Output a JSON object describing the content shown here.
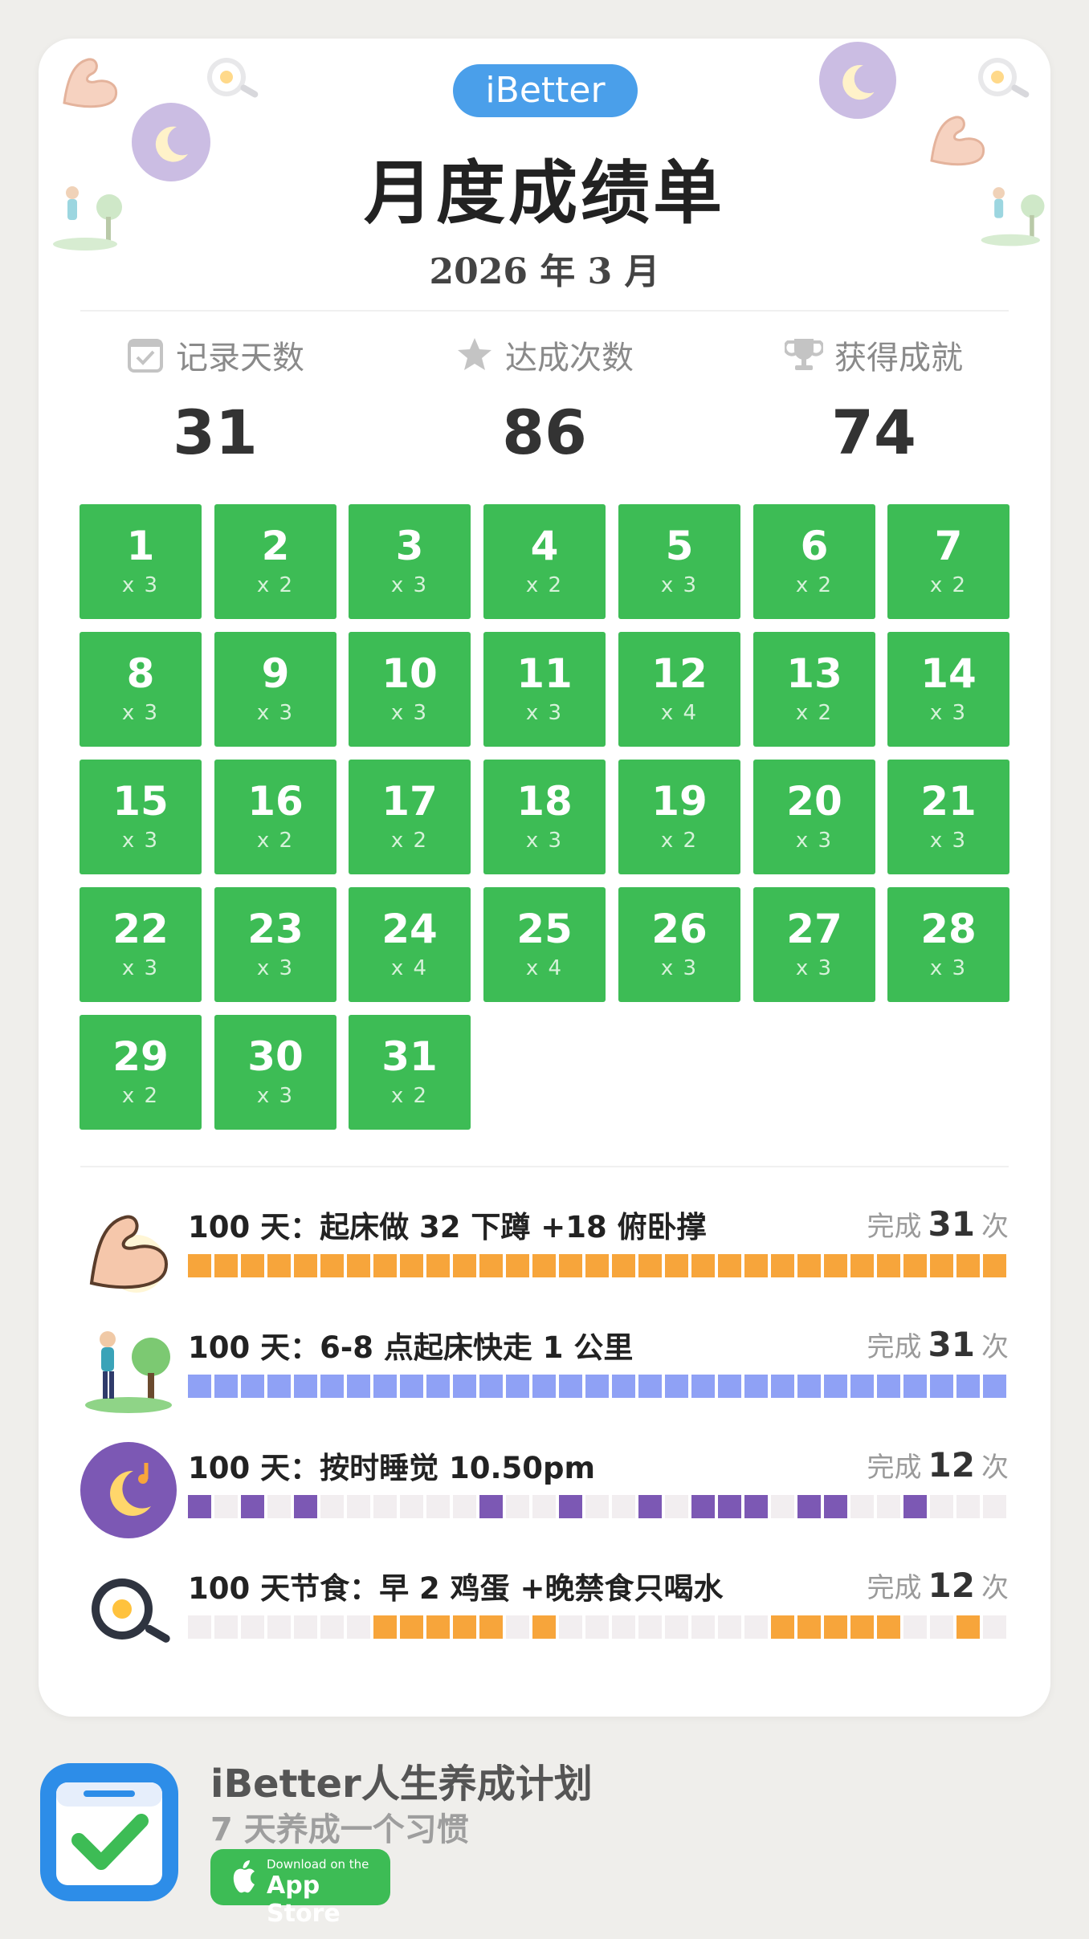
{
  "brand": "iBetter",
  "title": "月度成绩单",
  "month": "2026 年 3 月",
  "stats": [
    {
      "label": "记录天数",
      "value": "31",
      "icon": "calendar-check-icon"
    },
    {
      "label": "达成次数",
      "value": "86",
      "icon": "star-icon"
    },
    {
      "label": "获得成就",
      "value": "74",
      "icon": "trophy-icon"
    }
  ],
  "days": [
    {
      "day": "1",
      "count": "x 3"
    },
    {
      "day": "2",
      "count": "x 2"
    },
    {
      "day": "3",
      "count": "x 3"
    },
    {
      "day": "4",
      "count": "x 2"
    },
    {
      "day": "5",
      "count": "x 3"
    },
    {
      "day": "6",
      "count": "x 2"
    },
    {
      "day": "7",
      "count": "x 2"
    },
    {
      "day": "8",
      "count": "x 3"
    },
    {
      "day": "9",
      "count": "x 3"
    },
    {
      "day": "10",
      "count": "x 3"
    },
    {
      "day": "11",
      "count": "x 3"
    },
    {
      "day": "12",
      "count": "x 4"
    },
    {
      "day": "13",
      "count": "x 2"
    },
    {
      "day": "14",
      "count": "x 3"
    },
    {
      "day": "15",
      "count": "x 3"
    },
    {
      "day": "16",
      "count": "x 2"
    },
    {
      "day": "17",
      "count": "x 2"
    },
    {
      "day": "18",
      "count": "x 3"
    },
    {
      "day": "19",
      "count": "x 2"
    },
    {
      "day": "20",
      "count": "x 3"
    },
    {
      "day": "21",
      "count": "x 3"
    },
    {
      "day": "22",
      "count": "x 3"
    },
    {
      "day": "23",
      "count": "x 3"
    },
    {
      "day": "24",
      "count": "x 4"
    },
    {
      "day": "25",
      "count": "x 4"
    },
    {
      "day": "26",
      "count": "x 3"
    },
    {
      "day": "27",
      "count": "x 3"
    },
    {
      "day": "28",
      "count": "x 3"
    },
    {
      "day": "29",
      "count": "x 2"
    },
    {
      "day": "30",
      "count": "x 3"
    },
    {
      "day": "31",
      "count": "x 2"
    }
  ],
  "habits": [
    {
      "name": "100 天：起床做 32 下蹲 +18 俯卧撑",
      "done_prefix": "完成",
      "count": "31",
      "done_suffix": "次",
      "icon": "muscle-arm-icon",
      "color": "#f7a53b",
      "days": [
        1,
        1,
        1,
        1,
        1,
        1,
        1,
        1,
        1,
        1,
        1,
        1,
        1,
        1,
        1,
        1,
        1,
        1,
        1,
        1,
        1,
        1,
        1,
        1,
        1,
        1,
        1,
        1,
        1,
        1,
        1
      ]
    },
    {
      "name": "100 天：6-8 点起床快走 1 公里",
      "done_prefix": "完成",
      "count": "31",
      "done_suffix": "次",
      "icon": "walking-person-icon",
      "color": "#8fa1f5",
      "days": [
        1,
        1,
        1,
        1,
        1,
        1,
        1,
        1,
        1,
        1,
        1,
        1,
        1,
        1,
        1,
        1,
        1,
        1,
        1,
        1,
        1,
        1,
        1,
        1,
        1,
        1,
        1,
        1,
        1,
        1,
        1
      ]
    },
    {
      "name": "100 天：按时睡觉 10.50pm",
      "done_prefix": "完成",
      "count": "12",
      "done_suffix": "次",
      "icon": "moon-sleep-icon",
      "color": "#7c58b4",
      "days": [
        1,
        0,
        1,
        0,
        1,
        0,
        0,
        0,
        0,
        0,
        0,
        1,
        0,
        0,
        1,
        0,
        0,
        1,
        0,
        1,
        1,
        1,
        0,
        1,
        1,
        0,
        0,
        1,
        0,
        0,
        0
      ]
    },
    {
      "name": "100 天节食：早 2 鸡蛋 +晚禁食只喝水",
      "done_prefix": "完成",
      "count": "12",
      "done_suffix": "次",
      "icon": "frying-pan-egg-icon",
      "color": "#f7a53b",
      "days": [
        0,
        0,
        0,
        0,
        0,
        0,
        0,
        1,
        1,
        1,
        1,
        1,
        0,
        1,
        0,
        0,
        0,
        0,
        0,
        0,
        0,
        0,
        1,
        1,
        1,
        1,
        1,
        0,
        0,
        1,
        0
      ]
    }
  ],
  "app": {
    "name": "iBetter人生养成计划",
    "tagline": "7 天养成一个习惯",
    "store_small": "Download on the",
    "store_big": "App Store"
  },
  "colors": {
    "grid_green": "#3dbc55",
    "brand_blue": "#4a9fea",
    "empty_cell": "#f2eef0"
  }
}
